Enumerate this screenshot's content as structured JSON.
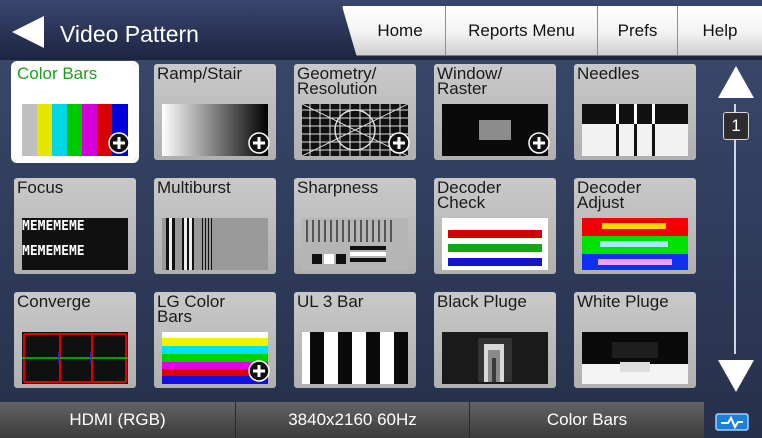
{
  "header": {
    "title": "Video Pattern",
    "nav": [
      "Home",
      "Reports Menu",
      "Prefs",
      "Help"
    ]
  },
  "patterns": [
    {
      "label": "Color Bars",
      "selected": true,
      "has_options": true
    },
    {
      "label": "Ramp/Stair",
      "has_options": true
    },
    {
      "label": "Geometry/\nResolution",
      "has_options": true
    },
    {
      "label": "Window/\nRaster",
      "has_options": true
    },
    {
      "label": "Needles"
    },
    {
      "label": "Focus"
    },
    {
      "label": "Multiburst"
    },
    {
      "label": "Sharpness"
    },
    {
      "label": "Decoder\nCheck"
    },
    {
      "label": "Decoder\nAdjust"
    },
    {
      "label": "Converge"
    },
    {
      "label": "LG Color\nBars",
      "has_options": true
    },
    {
      "label": "UL 3 Bar"
    },
    {
      "label": "Black Pluge"
    },
    {
      "label": "White Pluge"
    }
  ],
  "scroll": {
    "page": "1"
  },
  "status": {
    "interface": "HDMI (RGB)",
    "resolution": "3840x2160 60Hz",
    "pattern": "Color Bars"
  },
  "colors": {
    "selected_label": "#18a21a",
    "header_bg": "#2a3558"
  },
  "focus_text": "MEMEMEME"
}
